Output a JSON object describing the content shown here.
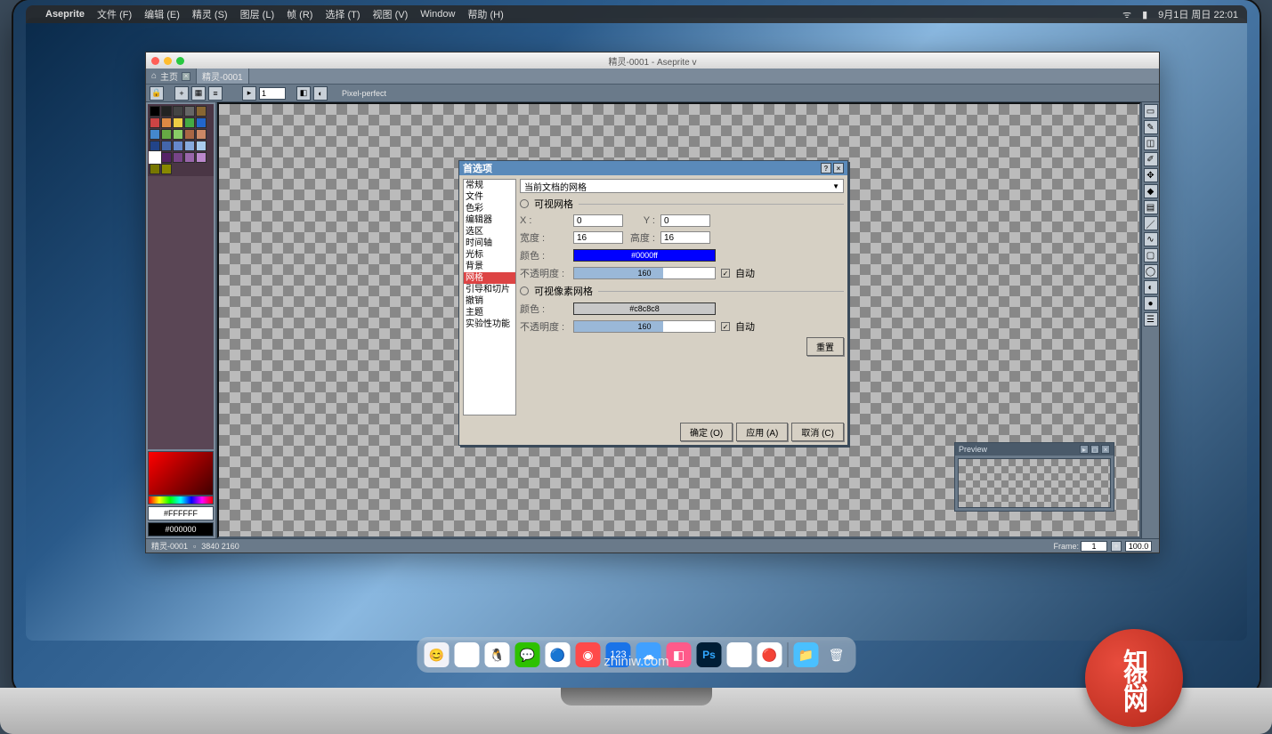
{
  "mac_menubar": {
    "app_name": "Aseprite",
    "items": [
      "文件 (F)",
      "编辑 (E)",
      "精灵 (S)",
      "图层 (L)",
      "帧 (R)",
      "选择 (T)",
      "视图 (V)",
      "Window",
      "帮助 (H)"
    ],
    "right_status": "9月1日 周日 22:01"
  },
  "window": {
    "title": "精灵-0001 - Aseprite v"
  },
  "tabs": [
    {
      "label": "主页",
      "icon": "⌂",
      "active": false
    },
    {
      "label": "精灵-0001",
      "icon": "",
      "active": true
    }
  ],
  "toolbar": {
    "zoom_value": "1",
    "pixel_perfect": "Pixel-perfect"
  },
  "palette": {
    "colors": [
      "#000000",
      "#222222",
      "#444444",
      "#666666",
      "#886633",
      "#cc4444",
      "#dd8844",
      "#eecc44",
      "#44aa44",
      "#2266cc",
      "#4488cc",
      "#66aa44",
      "#88cc66",
      "#aa6644",
      "#cc8866",
      "#224488",
      "#4466aa",
      "#6688cc",
      "#88aadd",
      "#aaccee",
      "#ffffff",
      "#552266",
      "#774488",
      "#9966aa",
      "#bb88cc",
      "#777700",
      "#888800"
    ],
    "selected_index": 20,
    "fg_hex": "#FFFFFF",
    "bg_hex": "#000000"
  },
  "right_tools": [
    {
      "name": "marquee-icon",
      "glyph": "▭"
    },
    {
      "name": "pencil-icon",
      "glyph": "✎"
    },
    {
      "name": "eraser-icon",
      "glyph": "◫"
    },
    {
      "name": "eyedropper-icon",
      "glyph": "✐"
    },
    {
      "name": "move-icon",
      "glyph": "✥"
    },
    {
      "name": "bucket-icon",
      "glyph": "◆"
    },
    {
      "name": "gradient-icon",
      "glyph": "▤"
    },
    {
      "name": "line-icon",
      "glyph": "／"
    },
    {
      "name": "curve-icon",
      "glyph": "∿"
    },
    {
      "name": "rect-icon",
      "glyph": "▢"
    },
    {
      "name": "ellipse-icon",
      "glyph": "◯"
    },
    {
      "name": "contour-icon",
      "glyph": "◐"
    },
    {
      "name": "blur-icon",
      "glyph": "●"
    },
    {
      "name": "jumble-icon",
      "glyph": "☰"
    }
  ],
  "preview": {
    "title": "Preview"
  },
  "status": {
    "doc_name": "精灵-0001",
    "dimensions": "3840 2160",
    "frame_label": "Frame:",
    "frame_value": "1",
    "zoom_pct": "100.0"
  },
  "dialog": {
    "title": "首选项",
    "sidebar_items": [
      "常规",
      "文件",
      "色彩",
      "编辑器",
      "选区",
      "时间轴",
      "光标",
      "背景",
      "网格",
      "引导和切片",
      "撤销",
      "主题",
      "实验性功能"
    ],
    "selected_sidebar": "网格",
    "dropdown_value": "当前文档的网格",
    "visible_grid_label": "可视网格",
    "x_label": "X :",
    "x_value": "0",
    "y_label": "Y :",
    "y_value": "0",
    "width_label": "宽度 :",
    "width_value": "16",
    "height_label": "高度 :",
    "height_value": "16",
    "color_label": "颜色 :",
    "color_value": "#0000FF",
    "color_text": "#0000ff",
    "opacity_label": "不透明度 :",
    "opacity_value": "160",
    "opacity_fill_pct": 63,
    "auto_label": "自动",
    "pixel_grid_label": "可视像素网格",
    "pixel_color_label": "颜色 :",
    "pixel_color_value": "#c8c8c8",
    "pixel_color_text": "#c8c8c8",
    "pixel_opacity_label": "不透明度 :",
    "pixel_opacity_value": "160",
    "pixel_opacity_fill_pct": 63,
    "reset_label": "重置",
    "ok_label": "确定 (O)",
    "apply_label": "应用 (A)",
    "cancel_label": "取消 (C)"
  },
  "brand": "zhiniw.com",
  "watermark_logo": "知您网"
}
